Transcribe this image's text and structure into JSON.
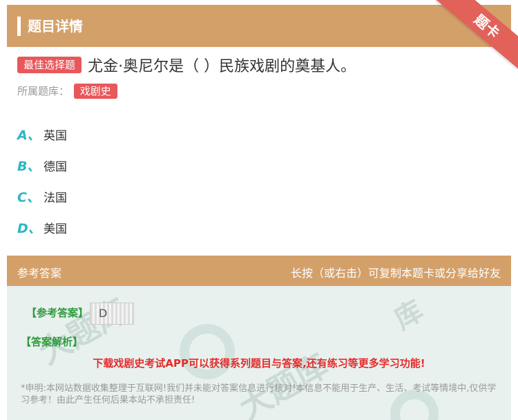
{
  "header": {
    "title": "题目详情",
    "ribbon": "题卡"
  },
  "question": {
    "tag": "最佳选择题",
    "text": "尤金·奥尼尔是（ ）民族戏剧的奠基人。",
    "bank_label": "所属题库：",
    "bank_tag": "戏剧史"
  },
  "options": [
    {
      "letter": "A、",
      "text": "英国"
    },
    {
      "letter": "B、",
      "text": "德国"
    },
    {
      "letter": "C、",
      "text": "法国"
    },
    {
      "letter": "D、",
      "text": "美国"
    }
  ],
  "answer_section": {
    "title": "参考答案",
    "hint": "长按（或右击）可复制本题卡或分享给好友",
    "ref_label": "【参考答案】",
    "ref_value": "D",
    "analysis_label": "【答案解析】",
    "promo": "下载戏剧史考试APP可以获得系列题目与答案,还有练习等更多学习功能!",
    "disclaimer": "*申明:本网站数据收集整理于互联网!我们并未能对答案信息进行核对!本信息不能用于生产、生活、考试等情境中,仅供学习参考！由此产生任何后果本站不承担责任!"
  },
  "colors": {
    "accent": "#d4a06a",
    "tag": "#e8575a",
    "letter": "#2cb6c4",
    "green": "#2e9b3e",
    "promo": "#e42b2b"
  }
}
